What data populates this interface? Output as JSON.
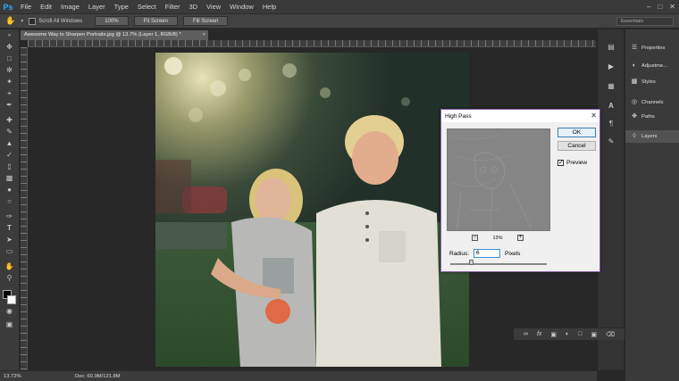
{
  "app": {
    "logo": "Ps"
  },
  "menu": [
    "File",
    "Edit",
    "Image",
    "Layer",
    "Type",
    "Select",
    "Filter",
    "3D",
    "View",
    "Window",
    "Help"
  ],
  "window_controls": [
    "–",
    "□",
    "✕"
  ],
  "options": {
    "scroll_all_label": "Scroll All Windows",
    "btn_100": "100%",
    "btn_fit": "Fit Screen",
    "btn_fill": "Fill Screen",
    "workspace": "Essentials"
  },
  "document": {
    "tab_title": "Awesome Way to Sharpen Portraits.jpg @ 13.7% (Layer 1, RGB/8) *",
    "tab_close": "×"
  },
  "status": {
    "zoom": "13.72%",
    "doc": "Doc: 60.9M/121.8M"
  },
  "panels": {
    "properties": "Properties",
    "adjustments": "Adjustme...",
    "styles": "Styles",
    "channels": "Channels",
    "paths": "Paths",
    "layers": "Layers"
  },
  "dialog": {
    "title": "High Pass",
    "close": "✕",
    "ok": "OK",
    "cancel": "Cancel",
    "preview_label": "Preview",
    "preview_checked": "✓",
    "zoom_minus": "−",
    "zoom_plus": "+",
    "zoom_pct": "13%",
    "radius_label": "Radius:",
    "radius_value": "6",
    "radius_unit": "Pixels"
  },
  "tools": [
    "move",
    "marquee",
    "lasso",
    "quick-select",
    "crop",
    "eyedropper",
    "healing",
    "brush",
    "stamp",
    "history-brush",
    "eraser",
    "gradient",
    "blur",
    "dodge",
    "pen",
    "type",
    "path-select",
    "shape",
    "hand",
    "zoom"
  ],
  "layer_footer_icons": [
    "link-icon",
    "fx-icon",
    "mask-icon",
    "adjustment-icon",
    "folder-icon",
    "new-layer-icon",
    "trash-icon"
  ]
}
